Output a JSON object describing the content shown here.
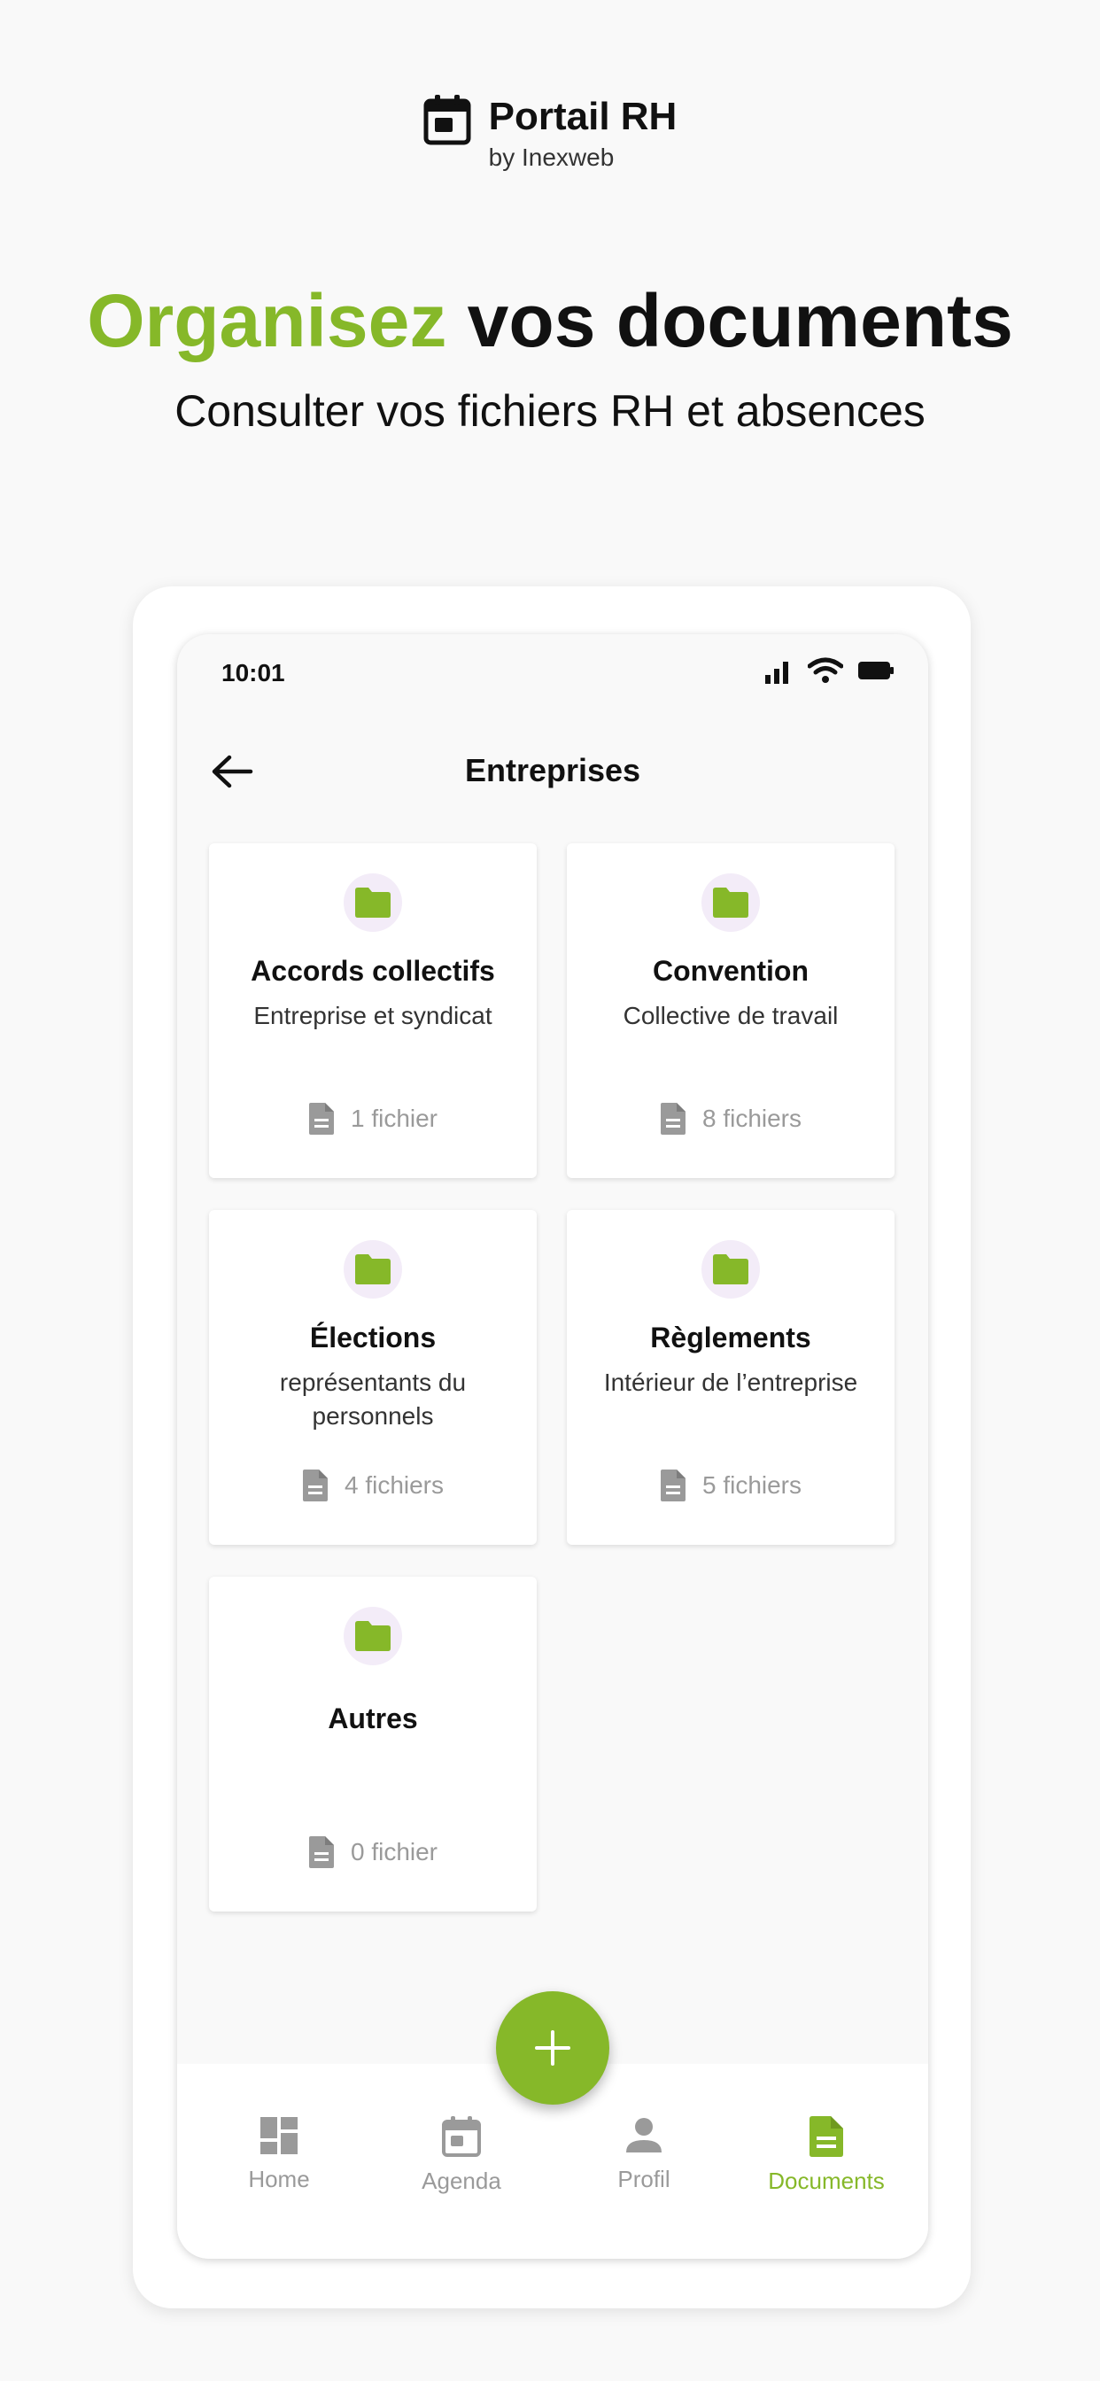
{
  "brand": {
    "title": "Portail RH",
    "subtitle": "by Inexweb"
  },
  "hero": {
    "headline_accent": "Organisez",
    "headline_rest": "vos documents",
    "tagline": "Consulter vos fichiers RH et absences"
  },
  "phone": {
    "status": {
      "time": "10:01"
    },
    "app_bar": {
      "title": "Entreprises"
    },
    "folders": [
      {
        "title": "Accords collectifs",
        "subtitle": "Entreprise et syndicat",
        "count": "1 fichier"
      },
      {
        "title": "Convention",
        "subtitle": "Collective de travail",
        "count": "8 fichiers"
      },
      {
        "title": "Élections",
        "subtitle": "représentants du personnels",
        "count": "4 fichiers"
      },
      {
        "title": "Règlements",
        "subtitle": "Intérieur de l’entreprise",
        "count": "5 fichiers"
      },
      {
        "title": "Autres",
        "subtitle": "",
        "count": "0 fichier"
      }
    ],
    "nav": [
      {
        "label": "Home",
        "icon": "dashboard-icon",
        "active": false
      },
      {
        "label": "Agenda",
        "icon": "calendar-icon",
        "active": false
      },
      {
        "label": "Profil",
        "icon": "person-icon",
        "active": false
      },
      {
        "label": "Documents",
        "icon": "document-icon",
        "active": true
      }
    ]
  },
  "colors": {
    "accent": "#86b829",
    "background": "#f9f9f9",
    "folder_badge": "#f3ecf8",
    "muted": "#9a9a9a"
  }
}
